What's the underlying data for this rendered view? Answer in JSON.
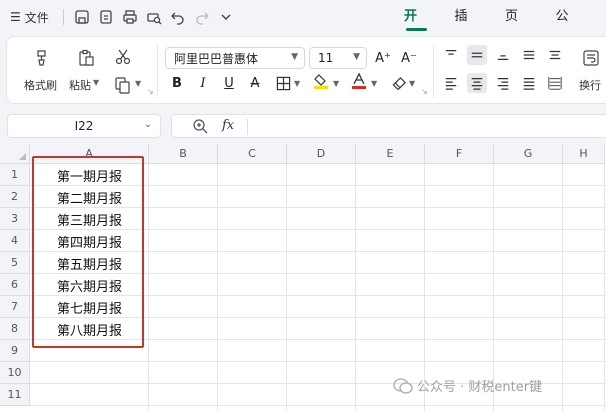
{
  "topbar": {
    "menu_icon": "hamburger-icon",
    "file_label": "文件",
    "quick_access": [
      "save-icon",
      "export-pdf-icon",
      "print-icon",
      "print-preview-icon",
      "undo-icon",
      "redo-icon",
      "more-chevron-icon"
    ],
    "tabs": [
      {
        "label": "开始",
        "active": true
      },
      {
        "label": "插入",
        "active": false
      },
      {
        "label": "页面",
        "active": false
      },
      {
        "label": "公式",
        "active": false
      }
    ]
  },
  "ribbon": {
    "format_painter_label": "格式刷",
    "paste_label": "粘贴",
    "font_name": "阿里巴巴普惠体",
    "font_size": "11",
    "bold": "B",
    "italic": "I",
    "underline": "U",
    "strikethrough": "A",
    "wrap_label": "换行",
    "accent_color": "#0a7a4b",
    "highlight_color": "#f5e100",
    "font_color": "#d32f2f"
  },
  "formula_bar": {
    "cell_ref": "I22",
    "fx_label": "fx",
    "formula": ""
  },
  "sheet": {
    "columns": [
      "A",
      "B",
      "C",
      "D",
      "E",
      "F",
      "G",
      "H"
    ],
    "rows": [
      "1",
      "2",
      "3",
      "4",
      "5",
      "6",
      "7",
      "8",
      "9",
      "10",
      "11"
    ],
    "cells_a": [
      "第一期月报",
      "第二期月报",
      "第三期月报",
      "第四期月报",
      "第五期月报",
      "第六期月报",
      "第七期月报",
      "第八期月报"
    ],
    "selection_color": "#c0392b"
  },
  "watermark": {
    "text": "公众号 · 财税enter键"
  }
}
